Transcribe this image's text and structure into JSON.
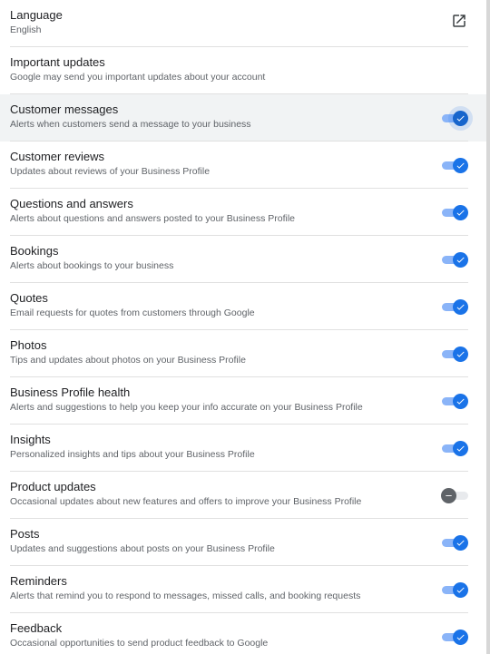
{
  "settings": [
    {
      "id": "language",
      "title": "Language",
      "subtitle": "English",
      "control": "external-link"
    },
    {
      "id": "important-updates",
      "title": "Important updates",
      "subtitle": "Google may send you important updates about your account",
      "control": "none"
    },
    {
      "id": "customer-messages",
      "title": "Customer messages",
      "subtitle": "Alerts when customers send a message to your business",
      "control": "toggle",
      "enabled": true,
      "hovered": true
    },
    {
      "id": "customer-reviews",
      "title": "Customer reviews",
      "subtitle": "Updates about reviews of your Business Profile",
      "control": "toggle",
      "enabled": true
    },
    {
      "id": "questions-and-answers",
      "title": "Questions and answers",
      "subtitle": "Alerts about questions and answers posted to your Business Profile",
      "control": "toggle",
      "enabled": true
    },
    {
      "id": "bookings",
      "title": "Bookings",
      "subtitle": "Alerts about bookings to your business",
      "control": "toggle",
      "enabled": true
    },
    {
      "id": "quotes",
      "title": "Quotes",
      "subtitle": "Email requests for quotes from customers through Google",
      "control": "toggle",
      "enabled": true
    },
    {
      "id": "photos",
      "title": "Photos",
      "subtitle": "Tips and updates about photos on your Business Profile",
      "control": "toggle",
      "enabled": true
    },
    {
      "id": "business-profile-health",
      "title": "Business Profile health",
      "subtitle": "Alerts and suggestions to help you keep your info accurate on your Business Profile",
      "control": "toggle",
      "enabled": true
    },
    {
      "id": "insights",
      "title": "Insights",
      "subtitle": "Personalized insights and tips about your Business Profile",
      "control": "toggle",
      "enabled": true
    },
    {
      "id": "product-updates",
      "title": "Product updates",
      "subtitle": "Occasional updates about new features and offers to improve your Business Profile",
      "control": "toggle",
      "enabled": false
    },
    {
      "id": "posts",
      "title": "Posts",
      "subtitle": "Updates and suggestions about posts on your Business Profile",
      "control": "toggle",
      "enabled": true
    },
    {
      "id": "reminders",
      "title": "Reminders",
      "subtitle": "Alerts that remind you to respond to messages, missed calls, and booking requests",
      "control": "toggle",
      "enabled": true
    },
    {
      "id": "feedback",
      "title": "Feedback",
      "subtitle": "Occasional opportunities to send product feedback to Google",
      "control": "toggle",
      "enabled": true
    }
  ],
  "colors": {
    "accent": "#1a73e8",
    "track_on": "#8ab4f8",
    "knob_off": "#5f6368",
    "track_off": "#e8eaed",
    "hover_row": "#f1f3f4"
  },
  "icons": {
    "language_link": "open-in-new-icon",
    "toggle_on": "check-icon",
    "toggle_off": "minus-icon"
  }
}
